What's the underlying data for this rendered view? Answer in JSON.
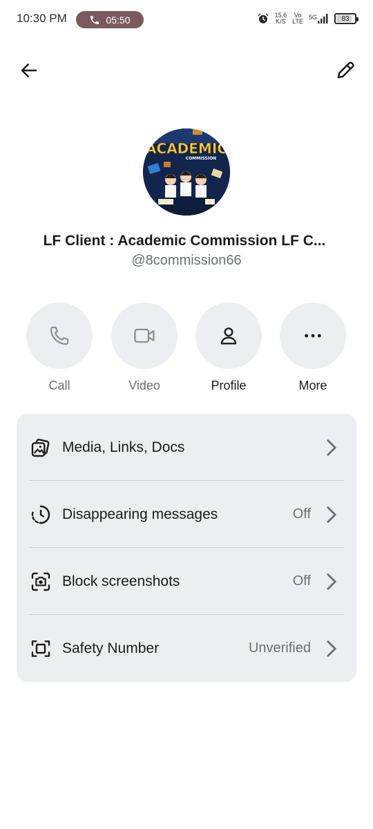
{
  "status_bar": {
    "time": "10:30 PM",
    "call_timer": "05:50",
    "speed_value": "15.6",
    "speed_unit": "K/S",
    "volte_top": "Vo",
    "volte_bottom": "LTE",
    "network": "5G",
    "battery": "83"
  },
  "nav": {
    "back_icon": "arrow-left-icon",
    "edit_icon": "pencil-icon"
  },
  "contact": {
    "avatar_text_main": "ACADEMIC",
    "avatar_text_sub": "COMMISSION",
    "name": "LF Client : Academic Commission LF C...",
    "username": "@8commission66"
  },
  "actions": [
    {
      "label": "Call",
      "icon": "phone-icon",
      "enabled": false
    },
    {
      "label": "Video",
      "icon": "video-camera-icon",
      "enabled": false
    },
    {
      "label": "Profile",
      "icon": "person-icon",
      "enabled": true
    },
    {
      "label": "More",
      "icon": "more-dots-icon",
      "enabled": true
    }
  ],
  "settings": [
    {
      "label": "Media, Links, Docs",
      "value": "",
      "icon": "media-icon"
    },
    {
      "label": "Disappearing messages",
      "value": "Off",
      "icon": "timer-icon"
    },
    {
      "label": "Block screenshots",
      "value": "Off",
      "icon": "screenshot-camera-icon"
    },
    {
      "label": "Safety Number",
      "value": "Unverified",
      "icon": "safety-number-icon"
    }
  ],
  "colors": {
    "background": "#ffffff",
    "card": "#eceef1",
    "muted_text": "#6b6f76",
    "call_pill": "#7a5a5a"
  }
}
